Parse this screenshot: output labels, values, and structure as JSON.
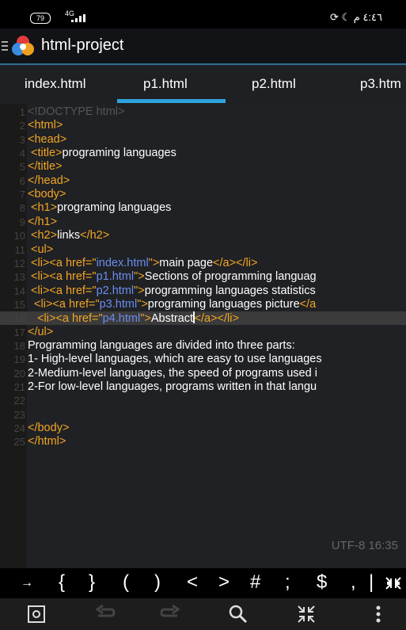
{
  "status_bar": {
    "battery": "79",
    "network": "4G",
    "time": "٤:٤٦ م"
  },
  "app": {
    "title": "html-project"
  },
  "tabs": [
    {
      "label": "index.html"
    },
    {
      "label": "p1.html"
    },
    {
      "label": "p2.html"
    },
    {
      "label": "p3.htm"
    }
  ],
  "editor": {
    "lines": [
      {
        "n": "1",
        "code": [
          {
            "t": "<!DOCTYPE html>",
            "c": "dim"
          }
        ]
      },
      {
        "n": "2",
        "code": [
          {
            "t": "<html>",
            "c": "tag"
          }
        ]
      },
      {
        "n": "3",
        "code": [
          {
            "t": "<head>",
            "c": "tag"
          }
        ]
      },
      {
        "n": "4",
        "code": [
          {
            "t": " <title>",
            "c": "tag"
          },
          {
            "t": "programing languages",
            "c": "txt"
          }
        ]
      },
      {
        "n": "5",
        "code": [
          {
            "t": "</title>",
            "c": "tag"
          }
        ]
      },
      {
        "n": "6",
        "code": [
          {
            "t": "</head>",
            "c": "tag"
          }
        ]
      },
      {
        "n": "7",
        "code": [
          {
            "t": "<body>",
            "c": "tag"
          }
        ]
      },
      {
        "n": "8",
        "code": [
          {
            "t": " <h1>",
            "c": "tag"
          },
          {
            "t": "programing languages",
            "c": "txt"
          }
        ]
      },
      {
        "n": "9",
        "code": [
          {
            "t": "</h1>",
            "c": "tag"
          }
        ]
      },
      {
        "n": "10",
        "code": [
          {
            "t": " <h2>",
            "c": "tag"
          },
          {
            "t": "links",
            "c": "txt"
          },
          {
            "t": "</h2>",
            "c": "tag"
          }
        ]
      },
      {
        "n": "11",
        "code": [
          {
            "t": " <ul>",
            "c": "tag"
          }
        ]
      },
      {
        "n": "12",
        "code": [
          {
            "t": " <li><a href=\"",
            "c": "tag"
          },
          {
            "t": "index.html",
            "c": "str"
          },
          {
            "t": "\">",
            "c": "tag"
          },
          {
            "t": "main page",
            "c": "txt"
          },
          {
            "t": "</a></li>",
            "c": "tag"
          }
        ]
      },
      {
        "n": "13",
        "code": [
          {
            "t": " <li><a href=\"",
            "c": "tag"
          },
          {
            "t": "p1.html",
            "c": "str"
          },
          {
            "t": "\">",
            "c": "tag"
          },
          {
            "t": "Sections of programming languag",
            "c": "txt"
          }
        ]
      },
      {
        "n": "14",
        "code": [
          {
            "t": " <li><a href=\"",
            "c": "tag"
          },
          {
            "t": "p2.html",
            "c": "str"
          },
          {
            "t": "\">",
            "c": "tag"
          },
          {
            "t": "programming languages statistics",
            "c": "txt"
          }
        ]
      },
      {
        "n": "15",
        "code": [
          {
            "t": "  <li><a href=\"",
            "c": "tag"
          },
          {
            "t": "p3.html",
            "c": "str"
          },
          {
            "t": "\">",
            "c": "tag"
          },
          {
            "t": "programing languages picture",
            "c": "txt"
          },
          {
            "t": "</a",
            "c": "tag"
          }
        ]
      },
      {
        "n": "16",
        "active": true,
        "code": [
          {
            "t": "   <li><a href=\"",
            "c": "tag"
          },
          {
            "t": "p4.html",
            "c": "str"
          },
          {
            "t": "\">",
            "c": "tag"
          },
          {
            "t": "Abstract",
            "c": "txt"
          },
          {
            "t": "",
            "c": "cursor"
          },
          {
            "t": "</a></li>",
            "c": "tag"
          }
        ]
      },
      {
        "n": "17",
        "code": [
          {
            "t": "</ul>",
            "c": "tag"
          }
        ]
      },
      {
        "n": "18",
        "code": [
          {
            "t": "Programming languages are divided into three parts:",
            "c": "txt"
          }
        ]
      },
      {
        "n": "19",
        "code": [
          {
            "t": "1- High-level languages, which are easy to use languages",
            "c": "txt"
          }
        ]
      },
      {
        "n": "20",
        "code": [
          {
            "t": "2-Medium-level languages, the speed of programs used i",
            "c": "txt"
          }
        ]
      },
      {
        "n": "21",
        "code": [
          {
            "t": "2-For low-level languages, programs written in that langu",
            "c": "txt"
          }
        ]
      },
      {
        "n": "22",
        "code": []
      },
      {
        "n": "23",
        "code": []
      },
      {
        "n": "24",
        "code": [
          {
            "t": "</body>",
            "c": "tag"
          }
        ]
      },
      {
        "n": "25",
        "code": [
          {
            "t": "</html>",
            "c": "tag"
          }
        ]
      }
    ],
    "encoding": "UTF-8 16:35"
  },
  "symbols": [
    "→",
    "{",
    "}",
    "(",
    ")",
    "<",
    ">",
    "#",
    ";",
    "$",
    ",",
    "|"
  ],
  "colors": {
    "tag": "#f2a623",
    "string": "#6a8cf0",
    "accent": "#2ea4dc"
  }
}
